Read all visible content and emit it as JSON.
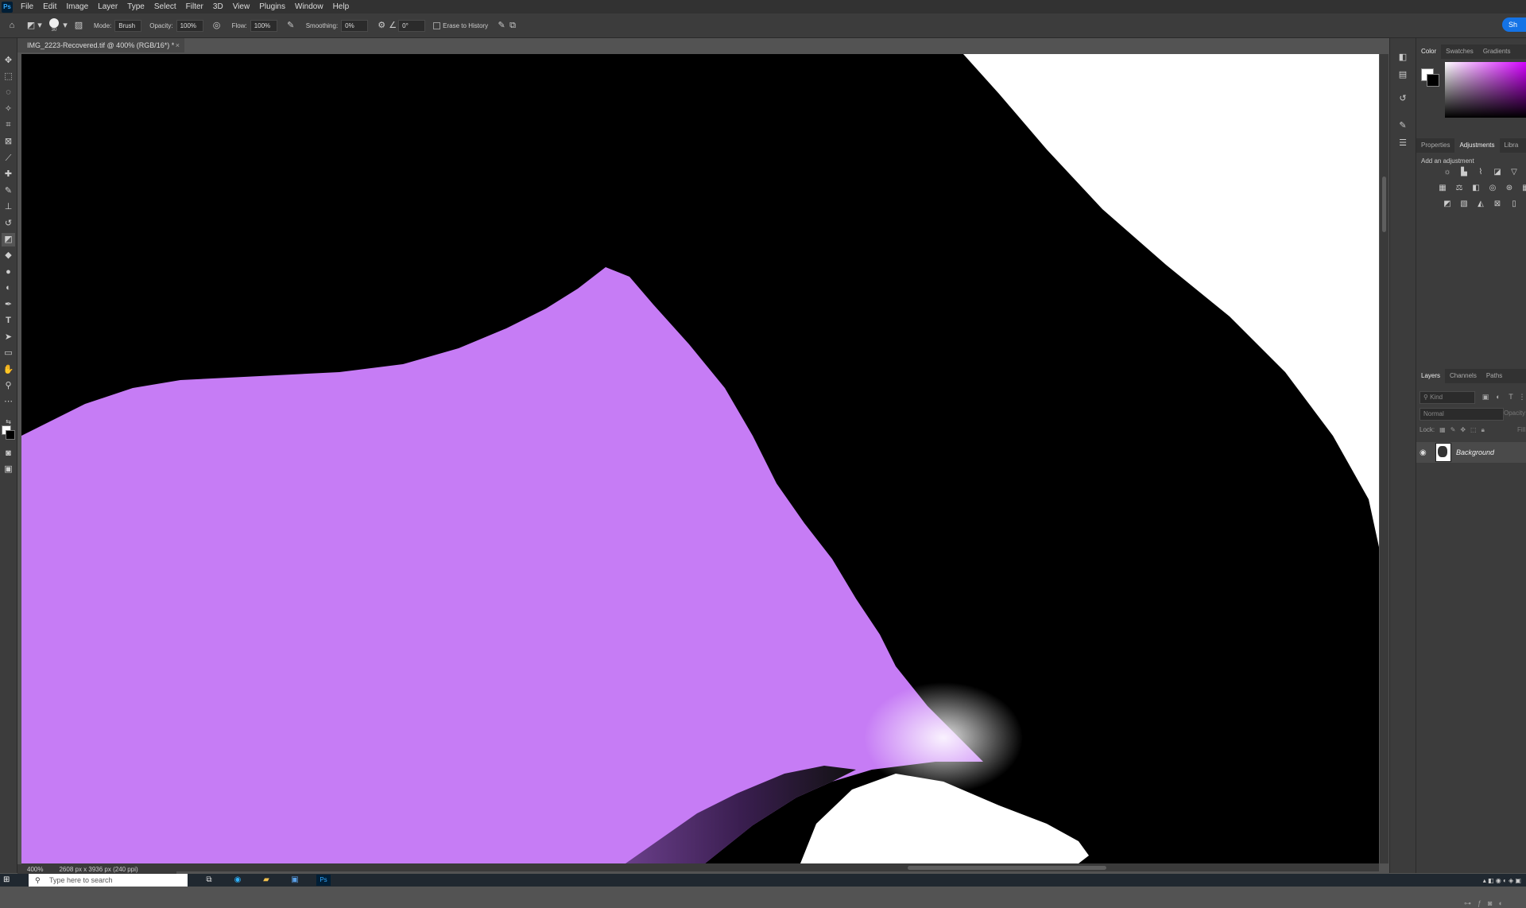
{
  "menubar": {
    "logo": "Ps",
    "items": [
      "File",
      "Edit",
      "Image",
      "Layer",
      "Type",
      "Select",
      "Filter",
      "3D",
      "View",
      "Plugins",
      "Window",
      "Help"
    ]
  },
  "options": {
    "brush_size": "30",
    "mode_label": "Mode:",
    "mode_value": "Brush",
    "opacity_label": "Opacity:",
    "opacity_value": "100%",
    "flow_label": "Flow:",
    "flow_value": "100%",
    "smoothing_label": "Smoothing:",
    "smoothing_value": "0%",
    "angle_value": "0°",
    "erase_history_label": "Erase to History",
    "share_label": "Sh"
  },
  "document": {
    "tab_title": "IMG_2223-Recovered.tif @ 400% (RGB/16*) *",
    "close_glyph": "×",
    "zoom": "400%",
    "doc_info": "2608 px x 3936 px (240 ppi)"
  },
  "panels": {
    "color_tabs": [
      "Color",
      "Swatches",
      "Gradients"
    ],
    "prop_tabs": [
      "Properties",
      "Adjustments",
      "Libra"
    ],
    "adjustments_title": "Add an adjustment",
    "layers_tabs": [
      "Layers",
      "Channels",
      "Paths"
    ],
    "layers_search_placeholder": "Kind",
    "blend_mode": "Normal",
    "opacity_label": "Opacity:",
    "lock_label": "Lock:",
    "fill_label": "Fill:",
    "layer_name": "Background"
  },
  "taskbar": {
    "search_placeholder": "Type here to search"
  },
  "colors": {
    "purple": "#c67cf5",
    "canvas_black": "#000000",
    "canvas_white": "#ffffff",
    "accent": "#1473e6"
  }
}
